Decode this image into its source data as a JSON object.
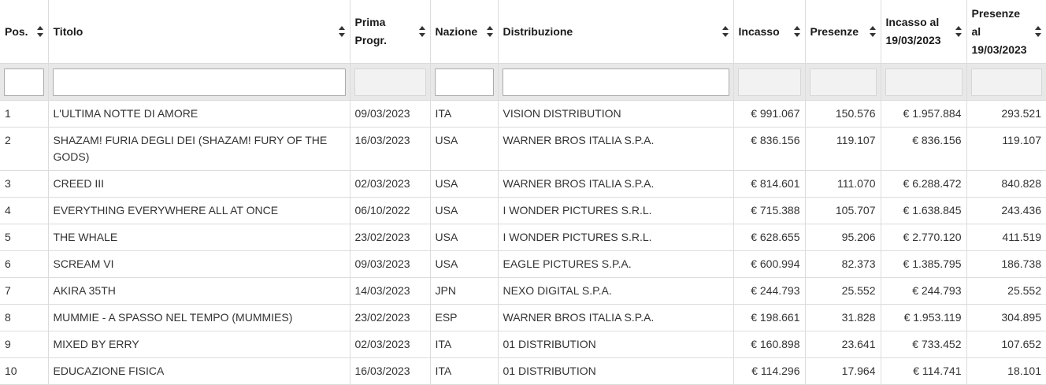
{
  "columns": {
    "pos": "Pos.",
    "titolo": "Titolo",
    "prima_1": "Prima",
    "prima_2": "Progr.",
    "nazione": "Nazione",
    "distribuzione": "Distribuzione",
    "incasso": "Incasso",
    "presenze": "Presenze",
    "incasso_al_1": "Incasso al",
    "incasso_al_2": "19/03/2023",
    "presenze_al_1": "Presenze",
    "presenze_al_2": "al",
    "presenze_al_3": "19/03/2023"
  },
  "rows": [
    {
      "pos": "1",
      "titolo": "L'ULTIMA NOTTE DI AMORE",
      "prima": "09/03/2023",
      "nazione": "ITA",
      "distribuzione": "VISION DISTRIBUTION",
      "incasso": "€ 991.067",
      "presenze": "150.576",
      "incasso_al": "€ 1.957.884",
      "presenze_al": "293.521"
    },
    {
      "pos": "2",
      "titolo": "SHAZAM! FURIA DEGLI DEI (SHAZAM! FURY OF THE GODS)",
      "prima": "16/03/2023",
      "nazione": "USA",
      "distribuzione": "WARNER BROS ITALIA S.P.A.",
      "incasso": "€ 836.156",
      "presenze": "119.107",
      "incasso_al": "€ 836.156",
      "presenze_al": "119.107"
    },
    {
      "pos": "3",
      "titolo": "CREED III",
      "prima": "02/03/2023",
      "nazione": "USA",
      "distribuzione": "WARNER BROS ITALIA S.P.A.",
      "incasso": "€ 814.601",
      "presenze": "111.070",
      "incasso_al": "€ 6.288.472",
      "presenze_al": "840.828"
    },
    {
      "pos": "4",
      "titolo": "EVERYTHING EVERYWHERE ALL AT ONCE",
      "prima": "06/10/2022",
      "nazione": "USA",
      "distribuzione": "I WONDER PICTURES S.R.L.",
      "incasso": "€ 715.388",
      "presenze": "105.707",
      "incasso_al": "€ 1.638.845",
      "presenze_al": "243.436"
    },
    {
      "pos": "5",
      "titolo": "THE WHALE",
      "prima": "23/02/2023",
      "nazione": "USA",
      "distribuzione": "I WONDER PICTURES S.R.L.",
      "incasso": "€ 628.655",
      "presenze": "95.206",
      "incasso_al": "€ 2.770.120",
      "presenze_al": "411.519"
    },
    {
      "pos": "6",
      "titolo": "SCREAM VI",
      "prima": "09/03/2023",
      "nazione": "USA",
      "distribuzione": "EAGLE PICTURES S.P.A.",
      "incasso": "€ 600.994",
      "presenze": "82.373",
      "incasso_al": "€ 1.385.795",
      "presenze_al": "186.738"
    },
    {
      "pos": "7",
      "titolo": "AKIRA 35TH",
      "prima": "14/03/2023",
      "nazione": "JPN",
      "distribuzione": "NEXO DIGITAL S.P.A.",
      "incasso": "€ 244.793",
      "presenze": "25.552",
      "incasso_al": "€ 244.793",
      "presenze_al": "25.552"
    },
    {
      "pos": "8",
      "titolo": "MUMMIE - A SPASSO NEL TEMPO (MUMMIES)",
      "prima": "23/02/2023",
      "nazione": "ESP",
      "distribuzione": "WARNER BROS ITALIA S.P.A.",
      "incasso": "€ 198.661",
      "presenze": "31.828",
      "incasso_al": "€ 1.953.119",
      "presenze_al": "304.895"
    },
    {
      "pos": "9",
      "titolo": "MIXED BY ERRY",
      "prima": "02/03/2023",
      "nazione": "ITA",
      "distribuzione": "01 DISTRIBUTION",
      "incasso": "€ 160.898",
      "presenze": "23.641",
      "incasso_al": "€ 733.452",
      "presenze_al": "107.652"
    },
    {
      "pos": "10",
      "titolo": "EDUCAZIONE FISICA",
      "prima": "16/03/2023",
      "nazione": "ITA",
      "distribuzione": "01 DISTRIBUTION",
      "incasso": "€ 114.296",
      "presenze": "17.964",
      "incasso_al": "€ 114.741",
      "presenze_al": "18.101"
    }
  ]
}
